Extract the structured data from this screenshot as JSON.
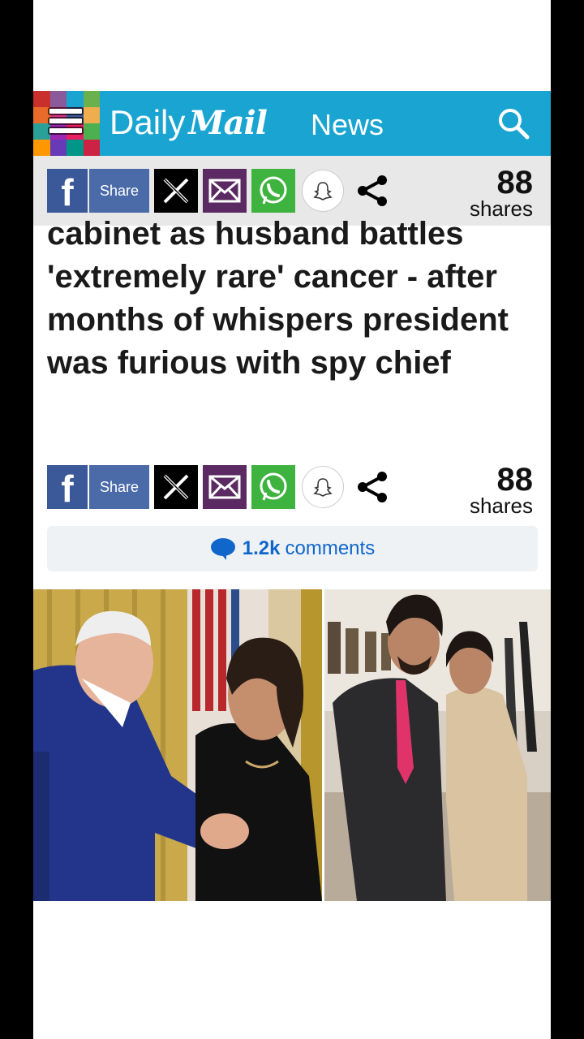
{
  "header": {
    "brand_daily": "Daily",
    "brand_mail": "Mail",
    "section": "News",
    "logo_colors": [
      "#c9302c",
      "#8b5a9a",
      "#1aa4d1",
      "#6ab04c",
      "#e86b2a",
      "#d63384",
      "#3b5998",
      "#f0ad4e",
      "#2aa198",
      "#9c27b0",
      "#e91e63",
      "#4caf50",
      "#ff9800",
      "#673ab7",
      "#009688",
      "#cc2244"
    ]
  },
  "share_bar_top": {
    "share_label": "Share",
    "count": "88",
    "count_label": "shares"
  },
  "headline": "cabinet as husband battles 'extremely rare' cancer - after months of whispers president was furious with spy chief",
  "share_bar_mid": {
    "share_label": "Share",
    "count": "88",
    "count_label": "shares"
  },
  "comments": {
    "count": "1.2k",
    "label": "comments"
  },
  "images": {
    "left": "photo-handshake",
    "right": "photo-couple-hallway"
  },
  "colors": {
    "header_bg": "#1aa4d1",
    "facebook": "#3b5998",
    "email": "#5b2a63",
    "whatsapp": "#3fb33f",
    "link": "#1166cc"
  }
}
